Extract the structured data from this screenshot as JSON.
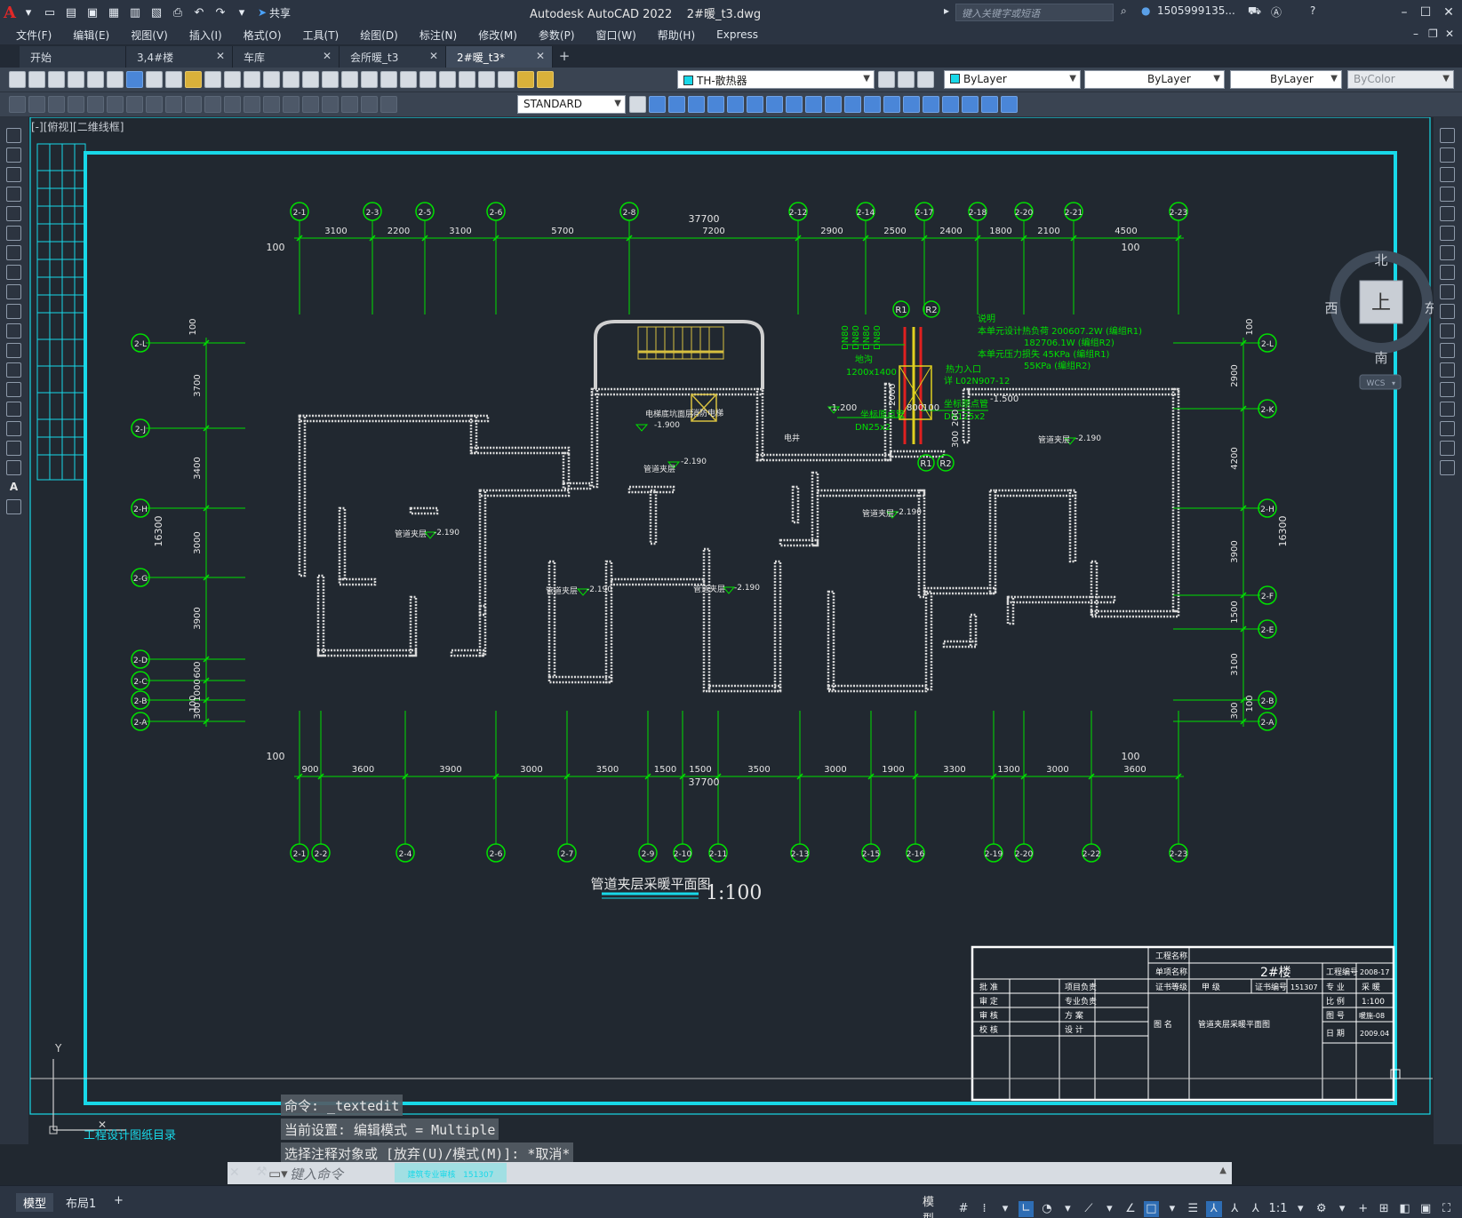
{
  "app": {
    "title": "Autodesk AutoCAD 2022",
    "file_name": "2#暖_t3.dwg",
    "share_label": "共享",
    "search_placeholder": "键入关键字或短语",
    "user": "1505999135...",
    "colors": {
      "accent_red": "#e22828",
      "frame_cyan": "#18d8e8",
      "cad_green": "#00e000",
      "bg": "#212830"
    }
  },
  "menu": [
    "文件(F)",
    "编辑(E)",
    "视图(V)",
    "插入(I)",
    "格式(O)",
    "工具(T)",
    "绘图(D)",
    "标注(N)",
    "修改(M)",
    "参数(P)",
    "窗口(W)",
    "帮助(H)",
    "Express"
  ],
  "tabs": [
    {
      "label": "开始",
      "closable": false
    },
    {
      "label": "3,4#楼",
      "closable": true
    },
    {
      "label": "车库",
      "closable": true
    },
    {
      "label": "会所暖_t3",
      "closable": true
    },
    {
      "label": "2#暖_t3*",
      "closable": true,
      "active": true
    }
  ],
  "toolbar": {
    "layer_name": "TH-散热器",
    "color_value": "ByLayer",
    "linetype_value": "ByLayer",
    "lineweight_value": "ByLayer",
    "plotstyle_value": "ByColor",
    "textstyle_value": "STANDARD"
  },
  "viewport": {
    "label": "[-][俯视][二维线框]",
    "viewcube": {
      "north": "北",
      "south": "南",
      "east": "东",
      "west": "西",
      "top": "上",
      "wcs": "WCS"
    }
  },
  "drawing": {
    "top_grid_labels": [
      "2-1",
      "2-3",
      "2-5",
      "2-6",
      "2-8",
      "2-12",
      "2-14",
      "2-17",
      "2-18",
      "2-20",
      "2-21",
      "2-23"
    ],
    "top_dims": [
      "3100",
      "2200",
      "3100",
      "5700",
      "7200",
      "2900",
      "2500",
      "2400",
      "1800",
      "2100",
      "4500"
    ],
    "top_total": "37700",
    "bottom_grid_labels": [
      "2-1",
      "2-2",
      "2-4",
      "2-6",
      "2-7",
      "2-9",
      "2-10",
      "2-11",
      "2-13",
      "2-15",
      "2-16",
      "2-19",
      "2-20",
      "2-22",
      "2-23"
    ],
    "bottom_dims": [
      "900",
      "3600",
      "3900",
      "3000",
      "3500",
      "1500",
      "1500",
      "3500",
      "3000",
      "1900",
      "3300",
      "1300",
      "3000",
      "3600"
    ],
    "bottom_total": "37700",
    "edge_100": "100",
    "left_grid_labels": [
      "2-L",
      "2-J",
      "2-H",
      "2-G",
      "2-D",
      "2-C",
      "2-B",
      "2-A"
    ],
    "left_dims": [
      "3700",
      "3400",
      "3000",
      "3900",
      "600",
      "1000",
      "300"
    ],
    "left_total": "16300",
    "right_grid_labels": [
      "2-L",
      "2-K",
      "2-H",
      "2-F",
      "2-E",
      "2-B",
      "2-A"
    ],
    "right_dims": [
      "2900",
      "4200",
      "3900",
      "1500",
      "3100",
      "300"
    ],
    "right_total": "16300",
    "riser_labels": [
      "R1",
      "R2"
    ],
    "notes": {
      "title": "说明",
      "line1": "本单元设计热负荷 200607.2W (编组R1)",
      "line2": "182706.1W (编组R2)",
      "line3": "本单元压力损失 45KPa (编组R1)",
      "line4": "55KPa (编组R2)",
      "well": "热力入口",
      "well_ref": "详 L02N907-12",
      "pit": "地沟",
      "pit_size": "1200x1400",
      "pipe_left": "DN25x2",
      "pipe_right": "DN125x2",
      "pipe_note": "坐标原点管",
      "elev_a": "-1.200",
      "elev_b": "-1.500",
      "dim_2000": "2000",
      "dim_800": "800",
      "dim_100": "100",
      "dim_300": "300",
      "dim_200": "200",
      "dn_labels": [
        "DN80",
        "DN80",
        "DN80",
        "DN80"
      ]
    },
    "room_labels": {
      "elev_label": "管道夹层",
      "elev_value": "-2.190",
      "elevator_room": "电梯底坑面层",
      "elevator_elev": "-1.900",
      "elevator_label": "消防电梯",
      "elec_room": "电井"
    },
    "drawing_title": "管道夹层采暖平面图",
    "scale": "1:100",
    "titleblock": {
      "project_name_lbl": "工程名称",
      "subproject_lbl": "单项名称",
      "subproject_val": "2#楼",
      "project_no_lbl": "工程编号",
      "project_no_val": "2008-17",
      "cert_grade_lbl": "证书等级",
      "cert_grade_val": "甲 级",
      "cert_no_lbl": "证书编号",
      "cert_no_val": "151307",
      "discipline_lbl": "专 业",
      "discipline_val": "采 暖",
      "scale_lbl": "比 例",
      "scale_val": "1:100",
      "sheet_no_lbl": "图 号",
      "sheet_no_val": "暖施-08",
      "date_lbl": "日 期",
      "date_val": "2009.04",
      "sheet_title_lbl": "图 名",
      "sheet_title_val": "管道夹层采暖平面图",
      "sign_rows": [
        {
          "left": "批 准",
          "right": "项目负责"
        },
        {
          "left": "审 定",
          "right": "专业负责"
        },
        {
          "left": "审 核",
          "right": "方 案"
        },
        {
          "left": "校 核",
          "right": "设 计"
        }
      ]
    },
    "catalog_label": "工程设计图纸目录",
    "ucs": {
      "y": "Y"
    }
  },
  "command": {
    "history": [
      "命令: _textedit",
      "当前设置: 编辑模式 = Multiple",
      "选择注释对象或 [放弃(U)/模式(M)]: *取消*"
    ],
    "placeholder": "键入命令",
    "overlay_text": "建筑专业审核",
    "overlay_no": "151307"
  },
  "statusbar": {
    "layout_tabs": [
      "模型",
      "布局1"
    ],
    "model_label": "模型",
    "scale": "1:1"
  }
}
